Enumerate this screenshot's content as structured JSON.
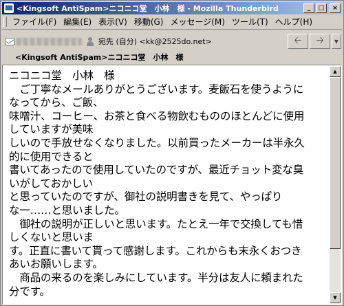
{
  "window": {
    "title": "<Kingsoft AntiSpam>ニコニコ堂　小林　様 - Mozilla Thunderbird",
    "controls": {
      "minimize": "_",
      "maximize": "□",
      "close": "×"
    }
  },
  "menubar": {
    "items": [
      "ファイル(F)",
      "編集(E)",
      "表示(V)",
      "移動(G)",
      "メッセージ(M)",
      "ツール(T)",
      "ヘルプ(H)"
    ]
  },
  "header": {
    "to_text": "宛先 (自分) <kk@2525do.net>",
    "subject": "<Kingsoft AntiSpam>ニコニコ堂　小林　様",
    "nav": {
      "reply_icon": "back-arrow-icon",
      "forward_icon": "forward-arrow-icon"
    }
  },
  "body": {
    "lines": [
      "ニコニコ堂　小林　様",
      "　ご丁寧なメールありがとうございます。麦飯石を使うように",
      "なってから、ご飯、",
      "味噌汁、コーヒー、お茶と食べる物飲むもののほとんどに使用",
      "していますが美味",
      "しいので手放せなくなりました。以前買ったメーカーは半永久",
      "的に使用できると",
      "書いてあったので使用していたのですが、最近チョット変な臭",
      "いがしておかしい",
      "と思っていたのですが、御社の説明書きを見て、やっぱり",
      "な一……と思いました。",
      "　御社の説明が正しいと思います。たとえ一年で交換しても惜",
      "しくないと思いま",
      "す。正直に書いて貰って感謝します。これからも末永くおつき",
      "あいお願いします。",
      "　商品の来るのを楽しみにしています。半分は友人に頼まれた",
      "分です。"
    ]
  },
  "colors": {
    "titlebar_start": "#0a246a",
    "titlebar_end": "#a6caf0",
    "chrome": "#d4d0c8"
  }
}
